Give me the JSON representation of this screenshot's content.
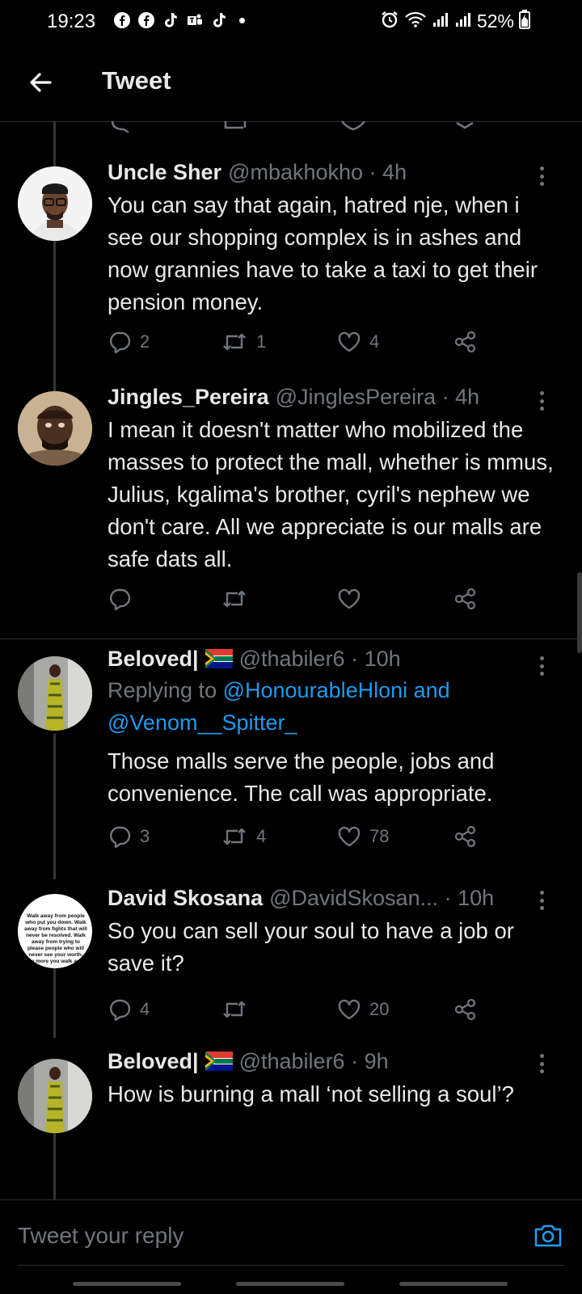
{
  "status_bar": {
    "time": "19:23",
    "battery": "52%",
    "left_icons": [
      "facebook-icon",
      "facebook-icon",
      "tiktok-icon",
      "teams-icon",
      "tiktok-icon",
      "dot"
    ],
    "right_icons": [
      "alarm-icon",
      "wifi-icon",
      "signal-icon",
      "signal-icon",
      "battery-icon"
    ]
  },
  "header": {
    "title": "Tweet"
  },
  "tweets": [
    {
      "name": "Uncle Sher",
      "handle": "@mbakhokho · 4h",
      "text": "You can say that again, hatred nje, when i see our shopping complex is in ashes and now grannies have to take a taxi to get their pension money.",
      "replies": "2",
      "retweets": "1",
      "likes": "4"
    },
    {
      "name": "Jingles_Pereira",
      "handle": "@JinglesPereira · 4h",
      "text": "I mean it doesn't matter who mobilized the masses to protect the mall, whether is mmus, Julius, kgalima's brother, cyril's nephew we don't care. All we appreciate is our malls are safe dats all.",
      "replies": "",
      "retweets": "",
      "likes": ""
    },
    {
      "name": "Beloved|",
      "handle": "@thabiler6 · 10h",
      "replying_prefix": "Replying to ",
      "replying_to": "@HonourableHloni and @Venom__Spitter_",
      "text": "Those malls serve the people, jobs and convenience. The call was appropriate.",
      "replies": "3",
      "retweets": "4",
      "likes": "78"
    },
    {
      "name": "David Skosana",
      "handle": "@DavidSkosan... · 10h",
      "text": "So you can sell your soul to have a job or save it?",
      "replies": "4",
      "retweets": "",
      "likes": "20",
      "avatar_text": "Walk away from people who put you down. Walk away from fights that will never be resolved. Walk away from trying to please people who will never see your worth. The more you walk away"
    },
    {
      "name": "Beloved|",
      "handle": "@thabiler6 · 9h",
      "text": "How is burning a mall ‘not selling a soul’?",
      "replies": "",
      "retweets": "",
      "likes": ""
    }
  ],
  "reply_bar": {
    "placeholder": "Tweet your reply"
  },
  "colors": {
    "background": "#000000",
    "text": "#e7e9ea",
    "muted": "#71767b",
    "link": "#1d9bf0",
    "divider": "#2f3336"
  }
}
